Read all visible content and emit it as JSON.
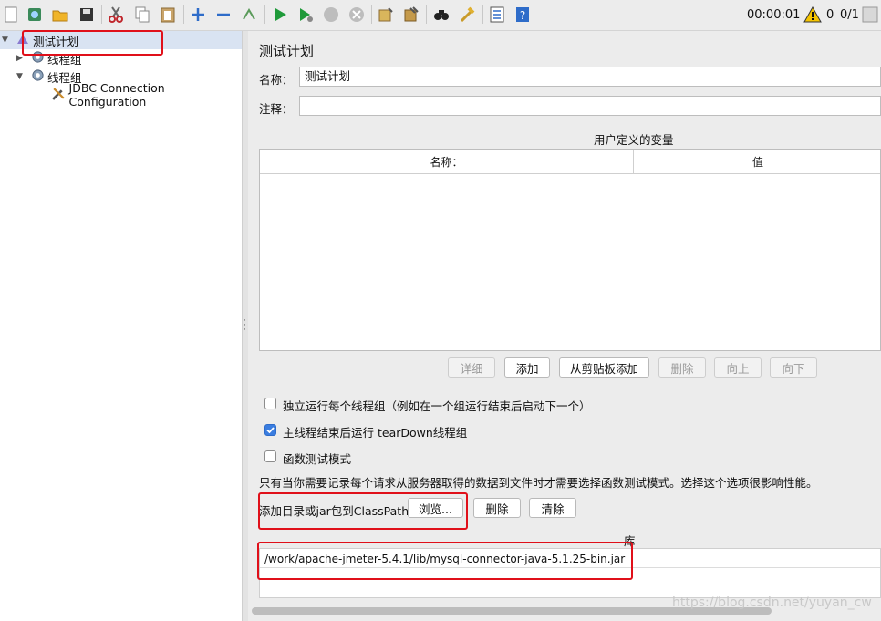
{
  "toolbar": {
    "icons": [
      "new-icon",
      "templates-icon",
      "open-icon",
      "save-icon",
      "cut-icon",
      "copy-icon",
      "paste-icon",
      "expand-icon",
      "collapse-icon",
      "toggle-icon",
      "start-icon",
      "start-no-pause-icon",
      "stop-icon",
      "shutdown-icon",
      "clear-icon",
      "clear-all-icon",
      "search-icon",
      "reset-search-icon",
      "function-helper-icon",
      "help-icon"
    ],
    "timer": "00:00:01",
    "warnings": "0",
    "threads": "0/1"
  },
  "tree": {
    "items": [
      {
        "label": "测试计划"
      },
      {
        "label": "线程组"
      },
      {
        "label": "线程组"
      },
      {
        "label": "JDBC Connection Configuration"
      }
    ]
  },
  "plan": {
    "title": "测试计划",
    "name_label": "名称：",
    "name_value": "测试计划",
    "comment_label": "注释：",
    "comment_value": "",
    "vars_title": "用户定义的变量",
    "vars_columns": [
      "名称：",
      "值"
    ],
    "buttons": {
      "detail": "详细",
      "add": "添加",
      "add_clipboard": "从剪贴板添加",
      "delete": "删除",
      "up": "向上",
      "down": "向下"
    },
    "options": {
      "serial_label": "独立运行每个线程组（例如在一个组运行结束后启动下一个）",
      "serial_checked": false,
      "teardown_label": "主线程结束后运行 tearDown线程组",
      "teardown_checked": true,
      "functional_label": "函数测试模式",
      "functional_checked": false
    },
    "functional_note": "只有当你需要记录每个请求从服务器取得的数据到文件时才需要选择函数测试模式。选择这个选项很影响性能。",
    "classpath": {
      "label": "添加目录或jar包到ClassPath",
      "browse": "浏览...",
      "delete": "删除",
      "clear": "清除",
      "lib_header": "库",
      "entries": [
        "/work/apache-jmeter-5.4.1/lib/mysql-connector-java-5.1.25-bin.jar"
      ]
    }
  },
  "watermark": "https://blog.csdn.net/yuyan_cw",
  "colors": {
    "highlight": "#e0101a",
    "checkbox_on": "#3a7de0"
  }
}
